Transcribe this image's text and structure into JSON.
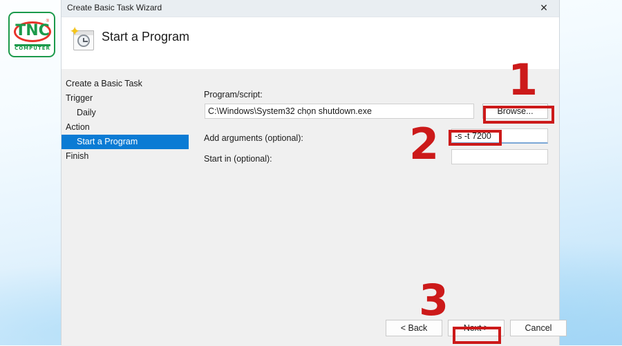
{
  "logo": {
    "brand": "TNC",
    "registered": "®",
    "subtitle": "COMPUTER"
  },
  "window": {
    "title": "Create Basic Task Wizard",
    "close_icon": "✕"
  },
  "header": {
    "icon": "scheduled-task-icon",
    "star": "✦",
    "heading": "Start a Program"
  },
  "sidebar": {
    "items": [
      {
        "label": "Create a Basic Task",
        "indent": false,
        "selected": false
      },
      {
        "label": "Trigger",
        "indent": false,
        "selected": false
      },
      {
        "label": "Daily",
        "indent": true,
        "selected": false
      },
      {
        "label": "Action",
        "indent": false,
        "selected": false
      },
      {
        "label": "Start a Program",
        "indent": true,
        "selected": true
      },
      {
        "label": "Finish",
        "indent": false,
        "selected": false
      }
    ]
  },
  "form": {
    "program_label": "Program/script:",
    "program_value": "C:\\Windows\\System32 chọn shutdown.exe",
    "browse_label": "Browse...",
    "arguments_label": "Add arguments (optional):",
    "arguments_value": "-s -t 7200",
    "start_in_label": "Start in (optional):",
    "start_in_value": ""
  },
  "footer": {
    "back_label": "< Back",
    "next_label": "Next >",
    "cancel_label": "Cancel"
  },
  "annotations": {
    "step1": "1",
    "step2": "2",
    "step3": "3",
    "color": "#cc1a1a"
  }
}
